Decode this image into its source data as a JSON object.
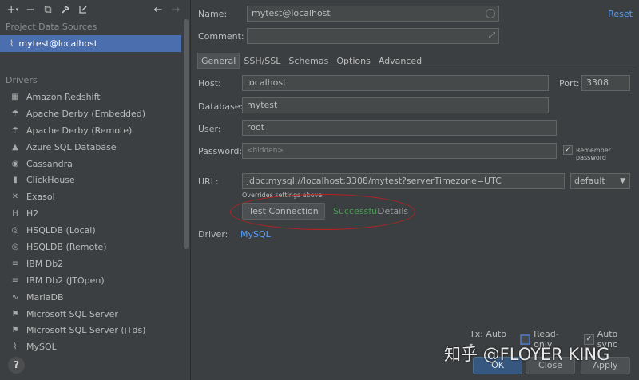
{
  "sidebar": {
    "project_section_title": "Project Data Sources",
    "datasource_item": "mytest@localhost",
    "drivers_section_title": "Drivers",
    "drivers": [
      {
        "label": "Amazon Redshift",
        "icon": "redshift-icon"
      },
      {
        "label": "Apache Derby (Embedded)",
        "icon": "derby-icon"
      },
      {
        "label": "Apache Derby (Remote)",
        "icon": "derby-icon"
      },
      {
        "label": "Azure SQL Database",
        "icon": "azure-icon"
      },
      {
        "label": "Cassandra",
        "icon": "cassandra-icon"
      },
      {
        "label": "ClickHouse",
        "icon": "clickhouse-icon"
      },
      {
        "label": "Exasol",
        "icon": "exasol-icon"
      },
      {
        "label": "H2",
        "icon": "h2-icon"
      },
      {
        "label": "HSQLDB (Local)",
        "icon": "hsqldb-icon"
      },
      {
        "label": "HSQLDB (Remote)",
        "icon": "hsqldb-icon"
      },
      {
        "label": "IBM Db2",
        "icon": "ibm-icon"
      },
      {
        "label": "IBM Db2 (JTOpen)",
        "icon": "ibm-icon"
      },
      {
        "label": "MariaDB",
        "icon": "mariadb-icon"
      },
      {
        "label": "Microsoft SQL Server",
        "icon": "mssql-icon"
      },
      {
        "label": "Microsoft SQL Server (jTds)",
        "icon": "mssql-icon"
      },
      {
        "label": "MySQL",
        "icon": "mysql-icon"
      }
    ],
    "help_label": "?"
  },
  "form": {
    "name_label": "Name:",
    "name_value": "mytest@localhost",
    "reset_label": "Reset",
    "comment_label": "Comment:",
    "comment_value": "",
    "tabs": [
      "General",
      "SSH/SSL",
      "Schemas",
      "Options",
      "Advanced"
    ],
    "host_label": "Host:",
    "host_value": "localhost",
    "port_label": "Port:",
    "port_value": "3308",
    "database_label": "Database:",
    "database_value": "mytest",
    "user_label": "User:",
    "user_value": "root",
    "password_label": "Password:",
    "password_placeholder": "<hidden>",
    "remember_password_label": "Remember password",
    "url_label": "URL:",
    "url_value": "jdbc:mysql://localhost:3308/mytest?serverTimezone=UTC",
    "url_hint": "Overrides settings above",
    "url_mode": "default",
    "test_connection_label": "Test Connection",
    "test_status": "Successful",
    "details_label": "Details",
    "driver_label": "Driver:",
    "driver_value": "MySQL"
  },
  "footer": {
    "tx_label": "Tx: Auto",
    "read_only_label": "Read-only",
    "auto_sync_label": "Auto sync",
    "ok_label": "OK",
    "close_label": "Close",
    "apply_label": "Apply"
  },
  "watermark": "知乎 @FLOYER KING",
  "colors": {
    "background": "#3c3f41",
    "selection": "#4b6eaf",
    "link": "#589df6",
    "success": "#499c54",
    "highlight_ring": "#b52222"
  }
}
